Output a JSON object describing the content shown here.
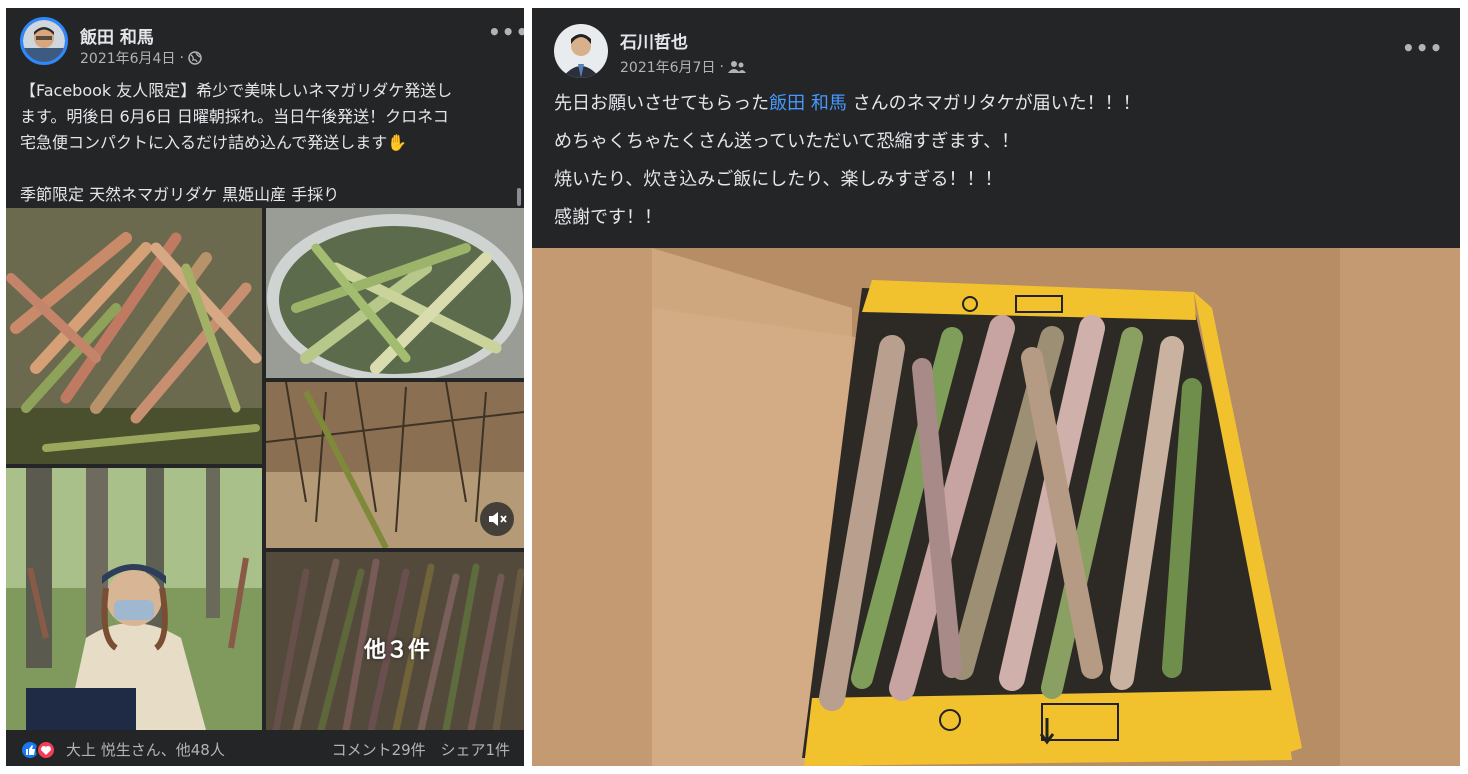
{
  "post1": {
    "author": "飯田 和馬",
    "date": "2021年6月4日",
    "date_sep": "·",
    "audience_icon": "globe-icon",
    "more_label": "•••",
    "text_lines": [
      "【Facebook 友人限定】希少で美味しいネマガリダケ発送し",
      "ます。明後日 6月6日 日曜朝採れ。当日午後発送！クロネコ",
      "宅急便コンパクトに入るだけ詰め込んで発送します✋",
      "",
      "季節限定 天然ネマガリダケ 黒姫山産 手採り"
    ],
    "more_photos_label": "他３件",
    "reactions": {
      "icons": [
        "like-icon",
        "love-icon"
      ],
      "likers": "大上 悦生さん、他48人",
      "comments": "コメント29件",
      "shares": "シェア1件"
    }
  },
  "post2": {
    "author": "石川哲也",
    "date": "2021年6月7日",
    "date_sep": "·",
    "audience_icon": "friends-icon",
    "more_label": "•••",
    "line1_before": "先日お願いさせてもらった",
    "line1_mention": "飯田 和馬",
    "line1_after": " さんのネマガリタケが届いた！！！",
    "line2": "めちゃくちゃたくさん送っていただいて恐縮すぎます、！",
    "line3": "焼いたり、炊き込みご飯にしたり、楽しみすぎる！！！",
    "line4": "感謝です！！"
  },
  "colors": {
    "card_bg": "#242526",
    "primary_text": "#e4e6eb",
    "secondary_text": "#b0b3b8",
    "mention": "#4599ff",
    "like_blue": "#1877f2",
    "love_red": "#f33e58"
  }
}
